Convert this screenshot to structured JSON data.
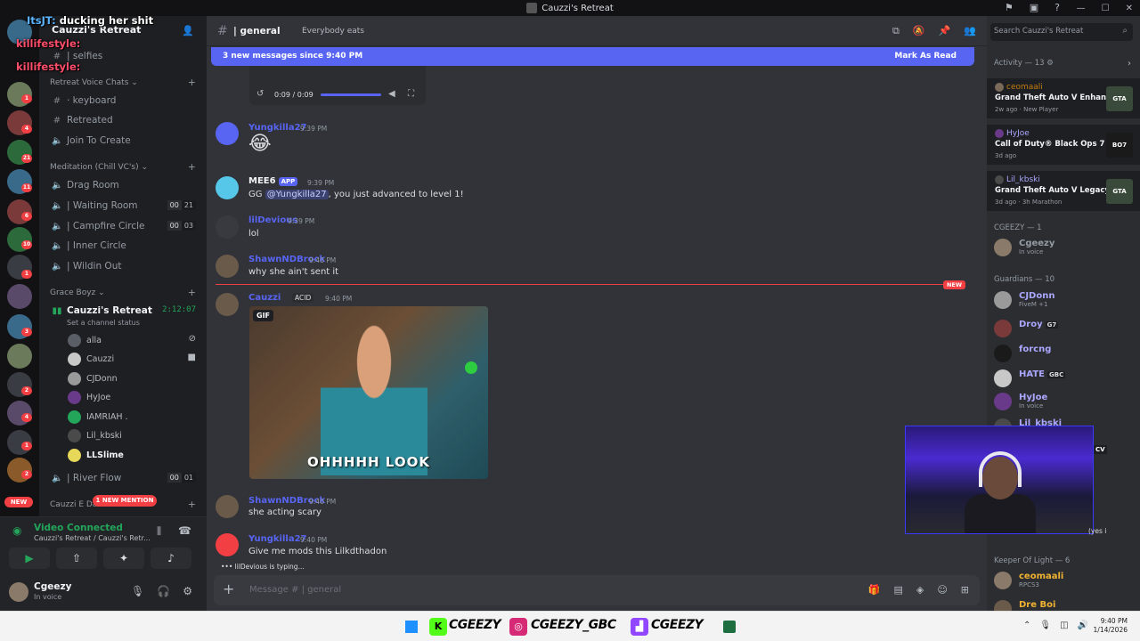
{
  "window": {
    "title": "Cauzzi's Retreat"
  },
  "overlay": [
    {
      "name": "ItsJT:",
      "text": "ducking her shit"
    },
    {
      "name": "killifestyle:",
      "text": ""
    },
    {
      "name": "killifestyle:",
      "text": ""
    }
  ],
  "server": {
    "name": "Cauzzi's Retreat"
  },
  "rail_badges": [
    "1",
    "4",
    "21",
    "11",
    "6",
    "10",
    "1",
    "3",
    "2",
    "4",
    "1",
    "2"
  ],
  "rail_new": "NEW",
  "channels": {
    "selfies": "| selfies",
    "cat_voice": "Retreat Voice Chats",
    "keyboard": "· keyboard",
    "retreated": "Retreated",
    "join_to_create": "Join To Create",
    "cat_meditation": "Meditation (Chill VC's)",
    "drag_room": "Drag Room",
    "waiting_room": "| Waiting Room",
    "waiting_count": [
      "00",
      "21"
    ],
    "campfire": "| Campfire Circle",
    "campfire_count": [
      "00",
      "03"
    ],
    "inner_circle": "| Inner Circle",
    "wildin_out": "| Wildin Out",
    "cat_grace": "Grace Boyz",
    "cauzzis_retreat": "Cauzzi's Retreat",
    "timer": "2:12:07",
    "channel_status": "Set a channel status",
    "voice_users": [
      "alla",
      "Cauzzi",
      "CJDonn",
      "HyJoe",
      "IAMRIAH .",
      "Lil_kbski",
      "LLSlime"
    ],
    "river_flow": "| River Flow",
    "river_count": [
      "00",
      "01"
    ],
    "cat_cauzzi": "Cauzzi E Da",
    "new_mention": "1 NEW MENTION"
  },
  "voice_panel": {
    "title": "Video Connected",
    "sub": "Cauzzi's Retreat / Cauzzi's Retr..."
  },
  "user": {
    "name": "Cgeezy",
    "status": "In voice"
  },
  "header": {
    "channel": "| general",
    "topic": "Everybody eats"
  },
  "newbar": {
    "left": "3 new messages since 9:40 PM",
    "right": "Mark As Read"
  },
  "video": {
    "time": "0:09 / 0:09"
  },
  "messages": [
    {
      "name": "Yungkilla27",
      "time": "9:39 PM",
      "text": "😂"
    },
    {
      "name": "MEE6",
      "tag": "APP",
      "time": "9:39 PM",
      "pre": "GG ",
      "mention": "@Yungkilla27",
      "post": ", you just advanced to level 1!"
    },
    {
      "name": "lilDevious",
      "time": "9:39 PM",
      "text": "lol"
    },
    {
      "name": "ShawnNDBrock",
      "time": "9:40 PM",
      "text": "why she ain't sent it"
    },
    {
      "name": "Cauzzi",
      "tag": "ACID",
      "time": "9:40 PM",
      "text": ""
    },
    {
      "name": "ShawnNDBrock",
      "time": "9:40 PM",
      "text": "she acting scary"
    },
    {
      "name": "Yungkilla27",
      "time": "9:40 PM",
      "text": "Give me mods this Lilkdthadon"
    }
  ],
  "new_tag": "NEW",
  "gif": {
    "tag": "GIF",
    "caption": "OHHHHH LOOK"
  },
  "typing": "lilDevious is typing...",
  "input": {
    "placeholder": "Message # | general"
  },
  "members": {
    "search": "Search Cauzzi's Retreat",
    "activity_header": "Activity — 13",
    "activity": [
      {
        "name": "ceomaali",
        "game": "Grand Theft Auto V Enhan...",
        "detail": "2w ago  ·  New Player",
        "thumb": "GTA"
      },
      {
        "name": "HyJoe",
        "game": "Call of Duty® Black Ops 7",
        "detail": "3d ago",
        "thumb": "BO7"
      },
      {
        "name": "Lil_kbski",
        "game": "Grand Theft Auto V Legacy",
        "detail": "3d ago  ·  3h Marathon",
        "thumb": "GTA"
      }
    ],
    "cgeezy_header": "CGEEZY — 1",
    "cgeezy": [
      {
        "name": "Cgeezy",
        "status": "In voice"
      }
    ],
    "guardians_header": "Guardians — 10",
    "guardians": [
      {
        "name": "CJDonn",
        "status": "FiveM +1"
      },
      {
        "name": "Droy",
        "tag": "G7",
        "status": ""
      },
      {
        "name": "forcng",
        "status": ""
      },
      {
        "name": "HATE",
        "tag": "GBC",
        "status": ""
      },
      {
        "name": "HyJoe",
        "status": "In voice"
      },
      {
        "name": "Lil_kbski",
        "status": ""
      }
    ],
    "cv_tag": "CV",
    "yes_tag": "(yes i",
    "keeper_header": "Keeper Of Light — 6",
    "keeper": [
      {
        "name": "ceomaali",
        "status": "RPCS3"
      },
      {
        "name": "Dre Boi",
        "status": ""
      }
    ]
  },
  "taskbar": {
    "names": [
      "CGEEZY",
      "CGEEZY_GBC",
      "CGEEZY"
    ],
    "time": "9:40 PM",
    "date": "1/14/2026"
  }
}
